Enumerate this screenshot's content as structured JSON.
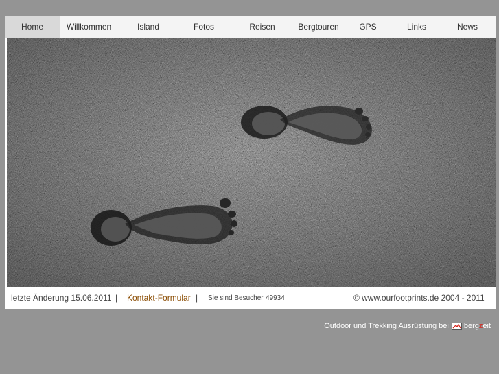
{
  "nav": {
    "items": [
      {
        "label": "Home",
        "name": "home"
      },
      {
        "label": "Willkommen",
        "name": "willkommen"
      },
      {
        "label": "Island",
        "name": "island"
      },
      {
        "label": "Fotos",
        "name": "fotos"
      },
      {
        "label": "Reisen",
        "name": "reisen"
      },
      {
        "label": "Bergtouren",
        "name": "bergtouren"
      },
      {
        "label": "GPS",
        "name": "gps"
      },
      {
        "label": "Links",
        "name": "links"
      },
      {
        "label": "News",
        "name": "news"
      }
    ],
    "active_index": 0
  },
  "footer": {
    "last_change": "letzte Änderung 15.06.2011",
    "separator": "|",
    "contact_link": "Kontakt-Formular",
    "visitor_label": "Sie sind Besucher",
    "visitor_count": "49934",
    "copyright": "© www.ourfootprints.de 2004 - 2011"
  },
  "sponsor": {
    "text": "Outdoor und Trekking Ausrüstung bei",
    "brand_part1": "berg",
    "brand_mid": "z",
    "brand_part2": "eit"
  },
  "colors": {
    "background": "#949494",
    "link": "#8a4b00",
    "brand_accent": "#d8261d"
  }
}
